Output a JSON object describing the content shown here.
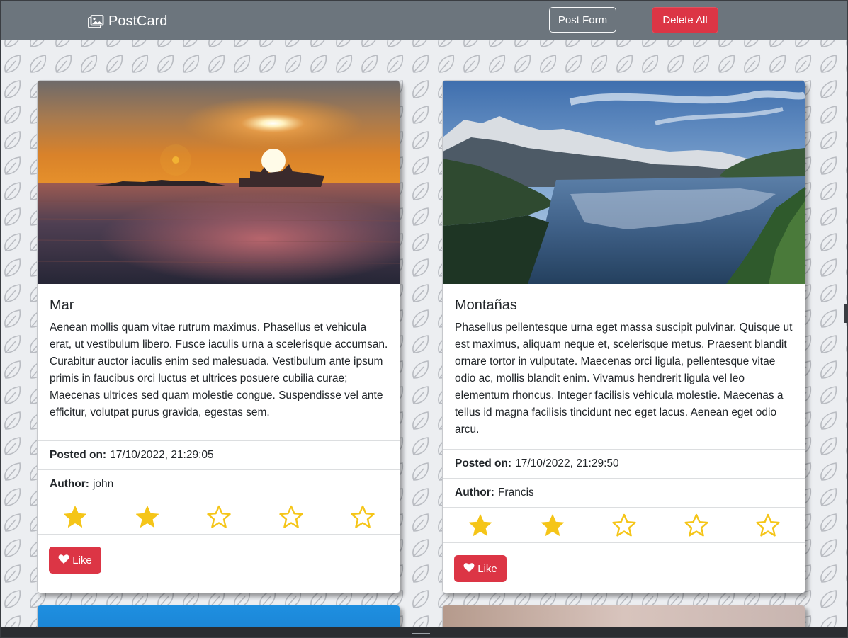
{
  "navbar": {
    "brand": "PostCard",
    "post_form_label": "Post Form",
    "delete_all_label": "Delete All"
  },
  "colors": {
    "navbar": "#6c757d",
    "danger": "#dc3545",
    "star": "#f5c518"
  },
  "cards": [
    {
      "title": "Mar",
      "text": "Aenean mollis quam vitae rutrum maximus. Phasellus et vehicula erat, ut vestibulum libero. Fusce iaculis urna a scelerisque accumsan. Curabitur auctor iaculis enim sed malesuada. Vestibulum ante ipsum primis in faucibus orci luctus et ultrices posuere cubilia curae; Maecenas ultrices sed quam molestie congue. Suspendisse vel ante efficitur, volutpat purus gravida, egestas sem.",
      "posted_label": "Posted on:",
      "posted_value": "17/10/2022, 21:29:05",
      "author_label": "Author:",
      "author_value": "john",
      "rating": 2,
      "rating_max": 5,
      "like_label": "Like",
      "image": "sunset-sea-ship"
    },
    {
      "title": "Montañas",
      "text": "Phasellus pellentesque urna eget massa suscipit pulvinar. Quisque ut est maximus, aliquam neque et, scelerisque metus. Praesent blandit ornare tortor in vulputate. Maecenas orci ligula, pellentesque vitae odio ac, mollis blandit enim. Vivamus hendrerit ligula vel leo elementum rhoncus. Integer facilisis vehicula molestie. Maecenas a tellus id magna facilisis tincidunt nec eget lacus. Aenean eget odio arcu.",
      "posted_label": "Posted on:",
      "posted_value": "17/10/2022, 21:29:50",
      "author_label": "Author:",
      "author_value": "Francis",
      "rating": 2,
      "rating_max": 5,
      "like_label": "Like",
      "image": "mountain-lake"
    }
  ]
}
